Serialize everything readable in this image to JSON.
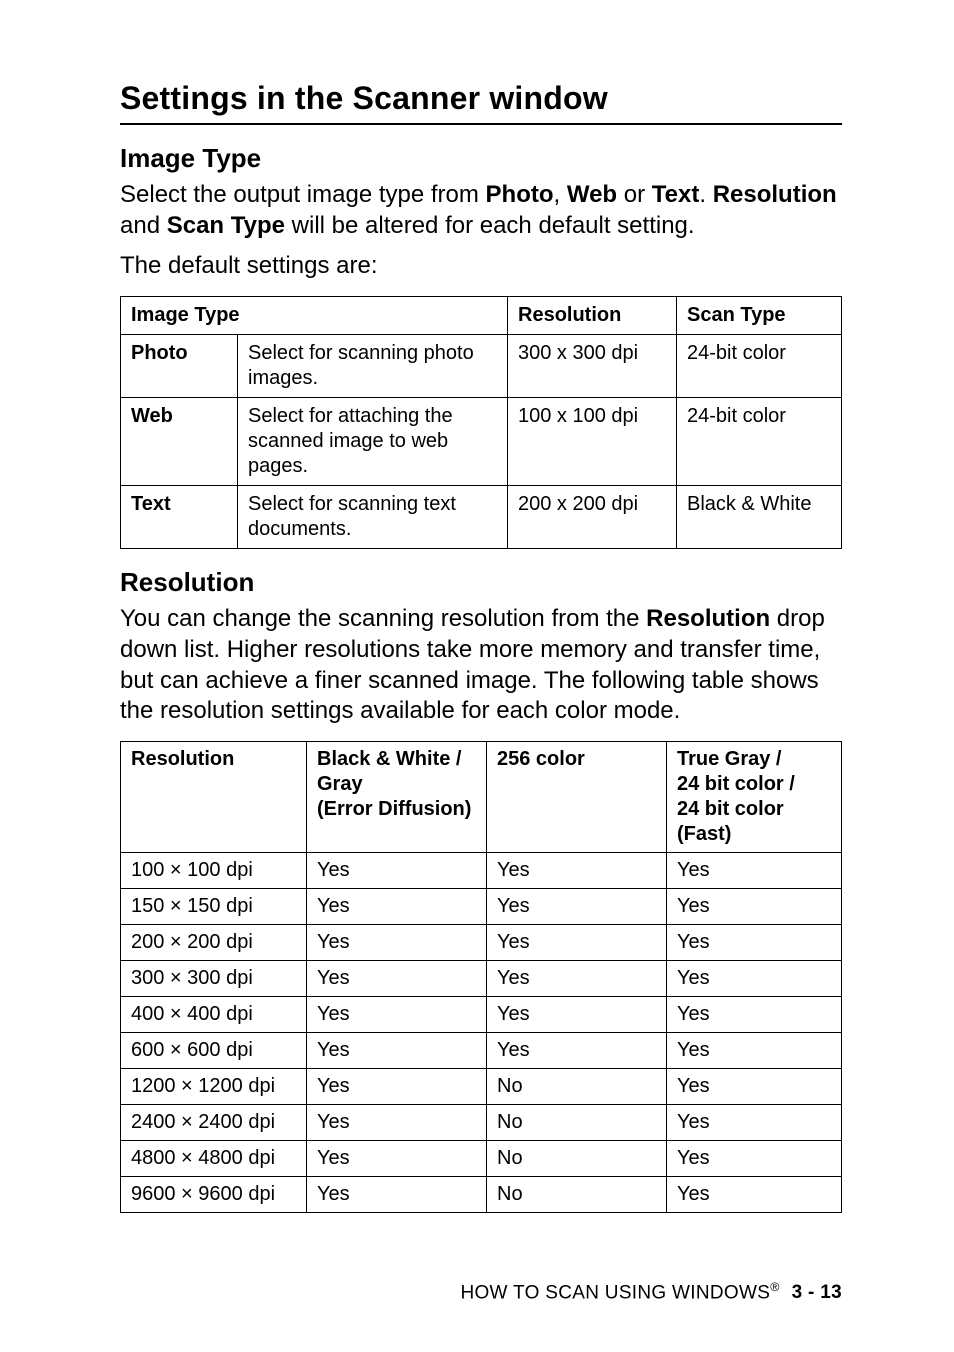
{
  "section_title": "Settings in the Scanner window",
  "image_type": {
    "heading": "Image Type",
    "intro_parts": [
      "Select the output image type from ",
      "Photo",
      ", ",
      "Web",
      " or ",
      "Text",
      ". ",
      "Resolution",
      " and ",
      "Scan Type",
      " will be altered for each default setting."
    ],
    "defaults_line": "The default settings are:",
    "table": {
      "headers": [
        "Image Type",
        "Resolution",
        "Scan Type"
      ],
      "rows": [
        {
          "type": "Photo",
          "desc": "Select for scanning photo images.",
          "res": "300 x 300 dpi",
          "scan": "24-bit color"
        },
        {
          "type": "Web",
          "desc": "Select for attaching the scanned image to web pages.",
          "res": "100 x 100 dpi",
          "scan": "24-bit color"
        },
        {
          "type": "Text",
          "desc": "Select for scanning text documents.",
          "res": "200 x 200 dpi",
          "scan": "Black & White"
        }
      ]
    }
  },
  "resolution": {
    "heading": "Resolution",
    "intro_parts": [
      "You can change the scanning resolution from the ",
      "Resolution",
      " drop down list. Higher resolutions take more memory and transfer time, but can achieve a finer scanned image. The following table shows the resolution settings available for each color mode."
    ],
    "table": {
      "headers": [
        "Resolution",
        "Black & White / Gray\n(Error Diffusion)",
        "256 color",
        "True Gray /\n24 bit color /\n24 bit color (Fast)"
      ],
      "rows": [
        {
          "res": "100 × 100 dpi",
          "bw": "Yes",
          "c256": "Yes",
          "tg": "Yes"
        },
        {
          "res": "150 × 150 dpi",
          "bw": "Yes",
          "c256": "Yes",
          "tg": "Yes"
        },
        {
          "res": "200 × 200 dpi",
          "bw": "Yes",
          "c256": "Yes",
          "tg": "Yes"
        },
        {
          "res": "300 × 300 dpi",
          "bw": "Yes",
          "c256": "Yes",
          "tg": "Yes"
        },
        {
          "res": "400 × 400 dpi",
          "bw": "Yes",
          "c256": "Yes",
          "tg": "Yes"
        },
        {
          "res": "600 × 600 dpi",
          "bw": "Yes",
          "c256": "Yes",
          "tg": "Yes"
        },
        {
          "res": "1200 × 1200 dpi",
          "bw": "Yes",
          "c256": "No",
          "tg": "Yes"
        },
        {
          "res": "2400 × 2400 dpi",
          "bw": "Yes",
          "c256": "No",
          "tg": "Yes"
        },
        {
          "res": "4800 × 4800 dpi",
          "bw": "Yes",
          "c256": "No",
          "tg": "Yes"
        },
        {
          "res": "9600 × 9600 dpi",
          "bw": "Yes",
          "c256": "No",
          "tg": "Yes"
        }
      ]
    }
  },
  "footer": {
    "text_prefix": "HOW TO SCAN USING WINDOWS",
    "reg": "®",
    "page": "3 - 13"
  }
}
